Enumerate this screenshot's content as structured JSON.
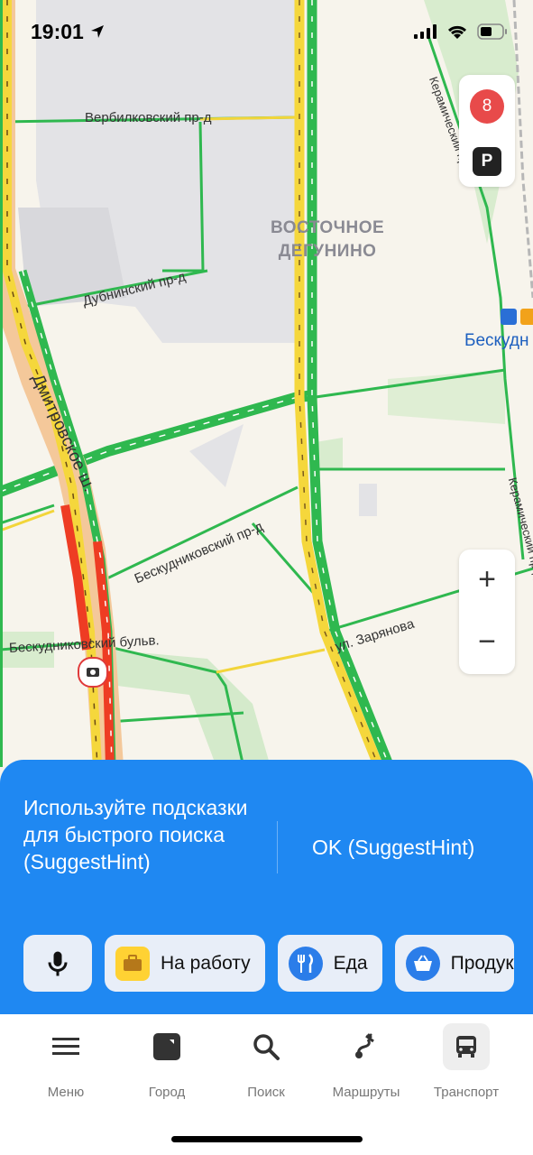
{
  "status_bar": {
    "time": "19:01"
  },
  "map": {
    "district_line1": "ВОСТОЧНОЕ",
    "district_line2": "ДЕГУНИНО",
    "streets": [
      "Вербилковский пр-д",
      "Дубнинский пр-д",
      "Дмитровское ш.",
      "Бескудниковский пр-д",
      "Бескудниковский бульв.",
      "ул. Заряновa",
      "Керамический пр-д",
      "Керамический пр-д"
    ],
    "metro_label": "Бескудн",
    "notification_count": "8",
    "parking_label": "P",
    "zoom_in": "+",
    "zoom_out": "−",
    "colors": {
      "road_green": "#2fb84f",
      "road_yellow": "#f5d73c",
      "road_red": "#ee3c23",
      "sheet_blue": "#1f88f2"
    }
  },
  "hint": {
    "text": "Используйте подсказки для быстрого поиска (SuggestHint)",
    "ok": "OK (SuggestHint)"
  },
  "chips": [
    {
      "icon": "microphone-icon",
      "label": ""
    },
    {
      "icon": "briefcase-icon",
      "label": "На работу"
    },
    {
      "icon": "fork-knife-icon",
      "label": "Еда"
    },
    {
      "icon": "basket-icon",
      "label": "Продук"
    }
  ],
  "tabs": [
    {
      "icon": "menu-icon",
      "label": "Меню"
    },
    {
      "icon": "city-icon",
      "label": "Город"
    },
    {
      "icon": "search-icon",
      "label": "Поиск"
    },
    {
      "icon": "routes-icon",
      "label": "Маршруты"
    },
    {
      "icon": "bus-icon",
      "label": "Транспорт"
    }
  ]
}
